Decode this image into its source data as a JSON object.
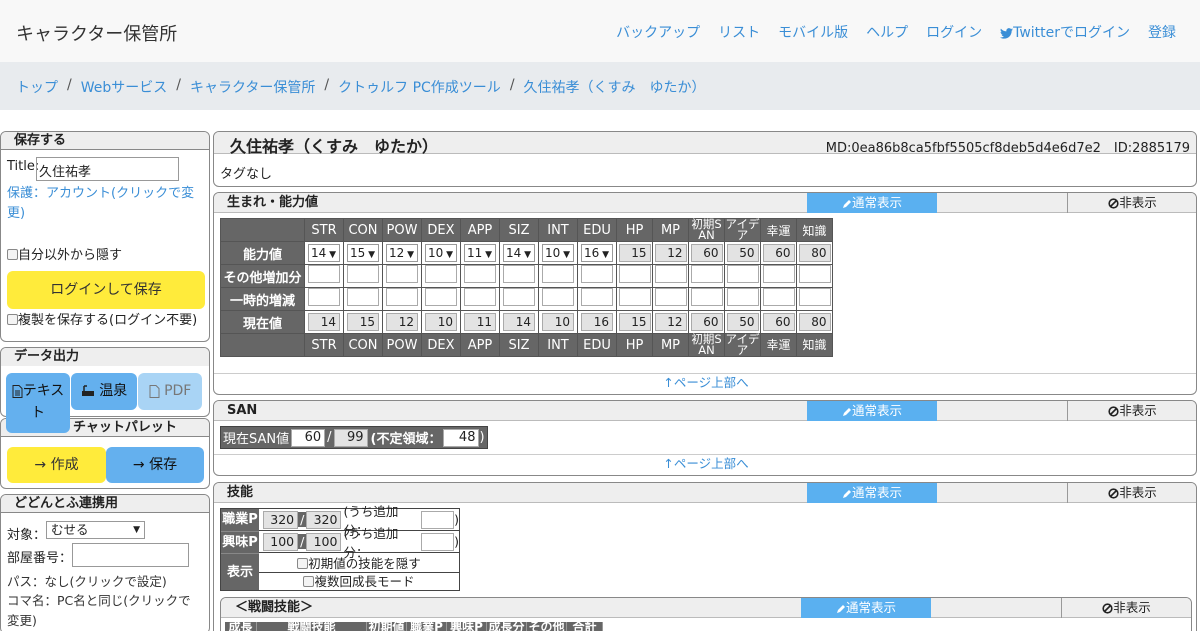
{
  "nav": {
    "brand": "キャラクター保管所",
    "links": [
      "バックアップ",
      "リスト",
      "モバイル版",
      "ヘルプ",
      "ログイン",
      "Twitterでログイン",
      "登録"
    ]
  },
  "breadcrumb": [
    "トップ",
    "Webサービス",
    "キャラクター保管所",
    "クトゥルフ PC作成ツール",
    "久住祐孝（くすみ　ゆたか）"
  ],
  "save": {
    "heading": "保存する",
    "title_label": "Title:",
    "title_value": "久住祐孝",
    "protect_text": "保護：アカウント(クリックで変更)",
    "hide_label": "自分以外から隠す",
    "login_save": "ログインして保存",
    "copy_label": "複製を保存する(ログイン不要)"
  },
  "export": {
    "heading": "データ出力",
    "text_btn": "テキスト",
    "onsen_btn": "温泉",
    "pdf_btn": "PDF"
  },
  "palette": {
    "heading": "チャットパレット",
    "create_btn": "→ 作成",
    "save_btn": "→ 保存"
  },
  "dodontof": {
    "heading": "どどんとふ連携用",
    "target_label": "対象：",
    "target_value": "むせる",
    "room_label": "部屋番号：",
    "pass_text": "パス：なし(クリックで設定)",
    "koma_text": "コマ名：PC名と同じ(クリックで変更)"
  },
  "character": {
    "name": "久住祐孝（くすみ　ゆたか）",
    "meta": "MD:0ea86b8ca5fbf5505cf8deb5d4e6d7e2　ID:2885179",
    "tags": "タグなし"
  },
  "common": {
    "normal_view": "通常表示",
    "hide": "非表示",
    "page_top": "↑ページ上部へ"
  },
  "abilities": {
    "heading": "生まれ・能力値",
    "columns": [
      "STR",
      "CON",
      "POW",
      "DEX",
      "APP",
      "SIZ",
      "INT",
      "EDU",
      "HP",
      "MP",
      "初期SAN",
      "アイデア",
      "幸運",
      "知識"
    ],
    "row_labels": [
      "能力値",
      "その他増加分",
      "一時的増減",
      "現在値"
    ],
    "base": [
      "14",
      "15",
      "12",
      "10",
      "11",
      "14",
      "10",
      "16",
      "15",
      "12",
      "60",
      "50",
      "60",
      "80"
    ],
    "current": [
      "14",
      "15",
      "12",
      "10",
      "11",
      "14",
      "10",
      "16",
      "15",
      "12",
      "60",
      "50",
      "60",
      "80"
    ]
  },
  "san": {
    "heading": "SAN",
    "current_label": "現在SAN値",
    "current": "60",
    "slash": "/",
    "max": "99",
    "indef_label": "(不定領域：",
    "indef": "48",
    "close": ")"
  },
  "skills": {
    "heading": "技能",
    "job_label": "職業P",
    "job_a": "320",
    "job_b": "320",
    "hobby_label": "興味P",
    "hobby_a": "100",
    "hobby_b": "100",
    "extra_label": "(うち追加分：",
    "close": ")",
    "display_label": "表示",
    "hide_initial": "初期値の技能を隠す",
    "multi_growth": "複数回成長モード",
    "combat_heading": "＜戦闘技能＞",
    "combat_cols": [
      "成長",
      "戦闘技能",
      "初期値",
      "職業P",
      "興味P",
      "成長分",
      "その他",
      "合計"
    ]
  }
}
